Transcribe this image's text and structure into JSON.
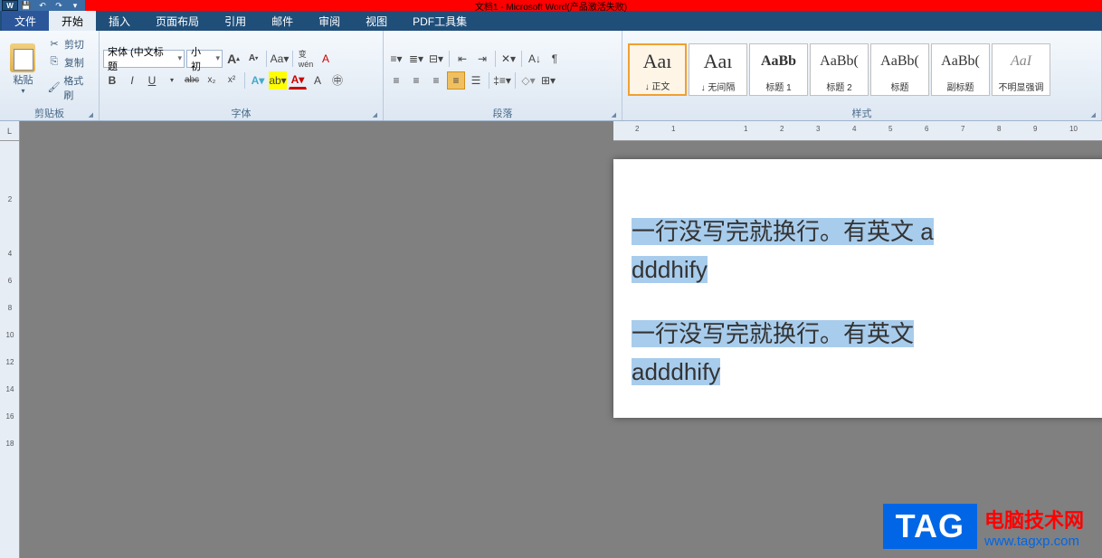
{
  "title": "文档1 - Microsoft Word(产品激活失败)",
  "qat": {
    "save": "💾",
    "undo": "↶",
    "redo": "↷"
  },
  "tabs": {
    "file": "文件",
    "items": [
      "开始",
      "插入",
      "页面布局",
      "引用",
      "邮件",
      "审阅",
      "视图",
      "PDF工具集"
    ],
    "active": 0
  },
  "clipboard": {
    "paste": "粘贴",
    "cut": "剪切",
    "copy": "复制",
    "format_painter": "格式刷",
    "label": "剪贴板"
  },
  "font": {
    "name": "宋体 (中文标题",
    "size": "小初",
    "grow": "A",
    "shrink": "A",
    "label": "字体",
    "btns": {
      "bold": "B",
      "italic": "I",
      "underline": "U",
      "strike": "abc",
      "sub": "x₂",
      "sup": "x²",
      "clear": "Aa",
      "phonetic": "拼",
      "charborder": "字",
      "enclosed": "A"
    }
  },
  "paragraph": {
    "label": "段落"
  },
  "styles": {
    "label": "样式",
    "items": [
      {
        "preview": "Aaı",
        "name": "↓ 正文",
        "sel": true
      },
      {
        "preview": "Aaı",
        "name": "↓ 无间隔"
      },
      {
        "preview": "AaBb",
        "name": "标题 1"
      },
      {
        "preview": "AaBb(",
        "name": "标题 2"
      },
      {
        "preview": "AaBb(",
        "name": "标题"
      },
      {
        "preview": "AaBb(",
        "name": "副标题"
      },
      {
        "preview": "AaI",
        "name": "不明显强调",
        "italic": true
      }
    ]
  },
  "ruler": {
    "corner": "L"
  },
  "document": {
    "line1": "一行没写完就换行。有英文 a",
    "line2": "dddhify",
    "line3": "一行没写完就换行。有英文",
    "line4": "adddhify"
  },
  "watermark": {
    "tag": "TAG",
    "line1": "电脑技术网",
    "line2": "www.tagxp.com"
  }
}
